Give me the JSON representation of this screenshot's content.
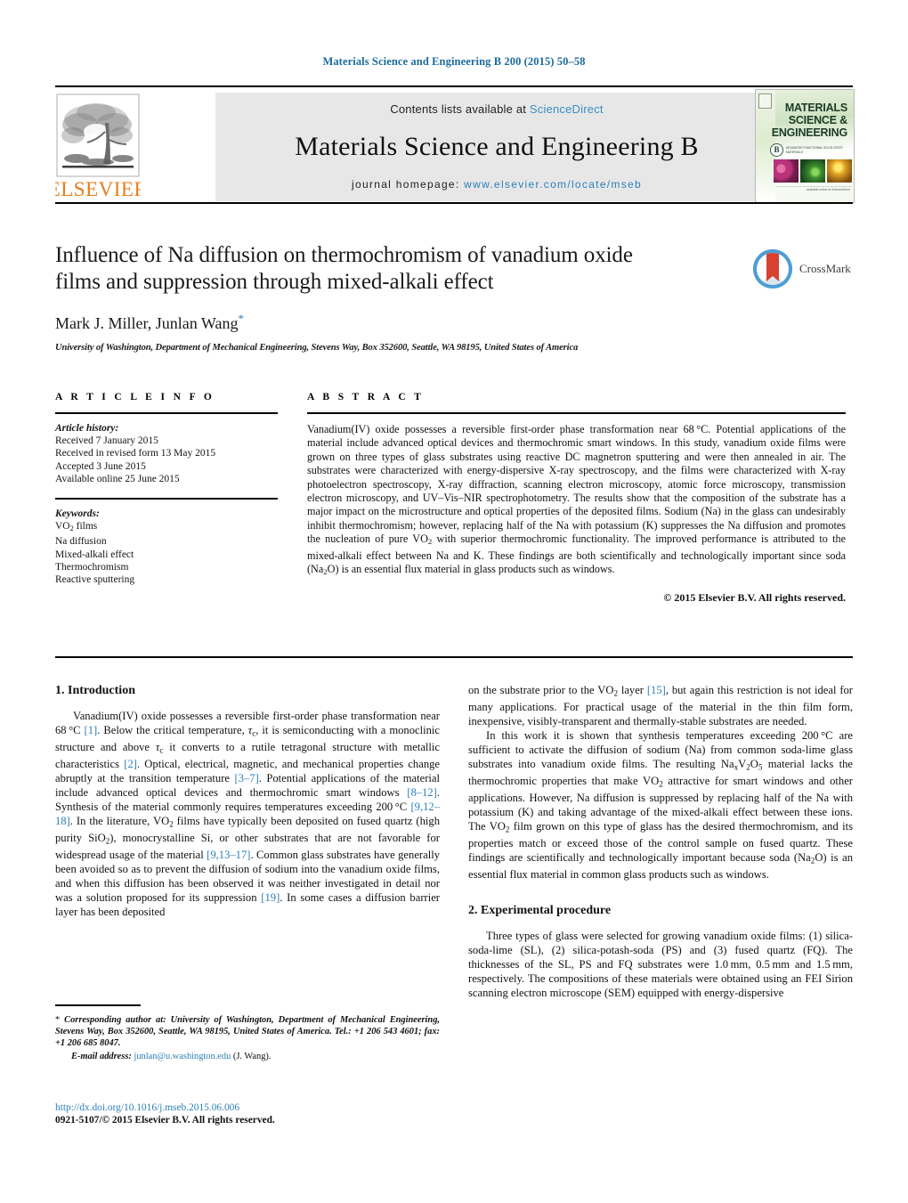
{
  "running_head": "Materials Science and Engineering B 200 (2015) 50–58",
  "masthead": {
    "contents_prefix": "Contents lists available at",
    "contents_link": "ScienceDirect",
    "journal_name": "Materials Science and Engineering B",
    "homepage_prefix": "journal homepage:",
    "homepage_url": "www.elsevier.com/locate/mseb",
    "publisher_logo_text": "ELSEVIER",
    "cover": {
      "title_line1": "MATERIALS",
      "title_line2": "SCIENCE &",
      "title_line3": "ENGINEERING",
      "series_letter": "B",
      "series_subtitle": "ADVANCED FUNCTIONAL SOLID-STATE MATERIALS",
      "footer": "available online at ScienceDirect"
    }
  },
  "article": {
    "title": "Influence of Na diffusion on thermochromism of vanadium oxide films and suppression through mixed-alkali effect",
    "authors": "Mark J. Miller, Junlan Wang",
    "corresponding_marker": "*",
    "affiliation": "University of Washington, Department of Mechanical Engineering, Stevens Way, Box 352600, Seattle, WA 98195, United States of America",
    "crossmark_label": "CrossMark"
  },
  "article_info": {
    "heading": "A R T I C L E   I N F O",
    "history_label": "Article history:",
    "history": [
      "Received 7 January 2015",
      "Received in revised form 13 May 2015",
      "Accepted 3 June 2015",
      "Available online 25 June 2015"
    ],
    "keywords_label": "Keywords:",
    "keywords": [
      "VO2 films",
      "Na diffusion",
      "Mixed-alkali effect",
      "Thermochromism",
      "Reactive sputtering"
    ]
  },
  "abstract": {
    "heading": "A B S T R A C T",
    "text": "Vanadium(IV) oxide possesses a reversible first-order phase transformation near 68 °C. Potential applications of the material include advanced optical devices and thermochromic smart windows. In this study, vanadium oxide films were grown on three types of glass substrates using reactive DC magnetron sputtering and were then annealed in air. The substrates were characterized with energy-dispersive X-ray spectroscopy, and the films were characterized with X-ray photoelectron spectroscopy, X-ray diffraction, scanning electron microscopy, atomic force microscopy, transmission electron microscopy, and UV–Vis–NIR spectrophotometry. The results show that the composition of the substrate has a major impact on the microstructure and optical properties of the deposited films. Sodium (Na) in the glass can undesirably inhibit thermochromism; however, replacing half of the Na with potassium (K) suppresses the Na diffusion and promotes the nucleation of pure VO2 with superior thermochromic functionality. The improved performance is attributed to the mixed-alkali effect between Na and K. These findings are both scientifically and technologically important since soda (Na2O) is an essential flux material in glass products such as windows.",
    "copyright": "© 2015 Elsevier B.V. All rights reserved."
  },
  "sections": {
    "intro_heading": "1.  Introduction",
    "intro_p1": "Vanadium(IV) oxide possesses a reversible first-order phase transformation near 68 °C [1]. Below the critical temperature, τc, it is semiconducting with a monoclinic structure and above τc it converts to a rutile tetragonal structure with metallic characteristics [2]. Optical, electrical, magnetic, and mechanical properties change abruptly at the transition temperature [3–7]. Potential applications of the material include advanced optical devices and thermochromic smart windows [8–12]. Synthesis of the material commonly requires temperatures exceeding 200 °C [9,12–18]. In the literature, VO2 films have typically been deposited on fused quartz (high purity SiO2), monocrystalline Si, or other substrates that are not favorable for widespread usage of the material [9,13–17]. Common glass substrates have generally been avoided so as to prevent the diffusion of sodium into the vanadium oxide films, and when this diffusion has been observed it was neither investigated in detail nor was a solution proposed for its suppression [19]. In some cases a diffusion barrier layer has been deposited on the substrate prior to the VO2 layer [15], but again this restriction is not ideal for many applications. For practical usage of the material in the thin film form, inexpensive, visibly-transparent and thermally-stable substrates are needed.",
    "intro_p2": "In this work it is shown that synthesis temperatures exceeding 200 °C are sufficient to activate the diffusion of sodium (Na) from common soda-lime glass substrates into vanadium oxide films. The resulting NaxV2O5 material lacks the thermochromic properties that make VO2 attractive for smart windows and other applications. However, Na diffusion is suppressed by replacing half of the Na with potassium (K) and taking advantage of the mixed-alkali effect between these ions. The VO2 film grown on this type of glass has the desired thermochromism, and its properties match or exceed those of the control sample on fused quartz. These findings are scientifically and technologically important because soda (Na2O) is an essential flux material in common glass products such as windows.",
    "experimental_heading": "2.  Experimental procedure",
    "experimental_p1": "Three types of glass were selected for growing vanadium oxide films: (1) silica-soda-lime (SL), (2) silica-potash-soda (PS) and (3) fused quartz (FQ). The thicknesses of the SL, PS and FQ substrates were 1.0 mm, 0.5 mm and 1.5 mm, respectively. The compositions of these materials were obtained using an FEI Sirion scanning electron microscope (SEM) equipped with energy-dispersive"
  },
  "footnote": {
    "marker": "*",
    "corresponding": "Corresponding author at: University of Washington, Department of Mechanical Engineering, Stevens Way, Box 352600, Seattle, WA 98195, United States of America. Tel.: +1 206 543 4601; fax: +1 206 685 8047.",
    "email_label": "E-mail address:",
    "email": "junlan@u.washington.edu",
    "email_owner": "(J. Wang)."
  },
  "doi": {
    "url": "http://dx.doi.org/10.1016/j.mseb.2015.06.006",
    "issn_line": "0921-5107/© 2015 Elsevier B.V. All rights reserved."
  },
  "colors": {
    "link_blue": "#2d7fb8",
    "running_head_blue": "#1b6b9c",
    "elsevier_orange": "#e87d1e",
    "band_grey": "#e7e7e8"
  }
}
